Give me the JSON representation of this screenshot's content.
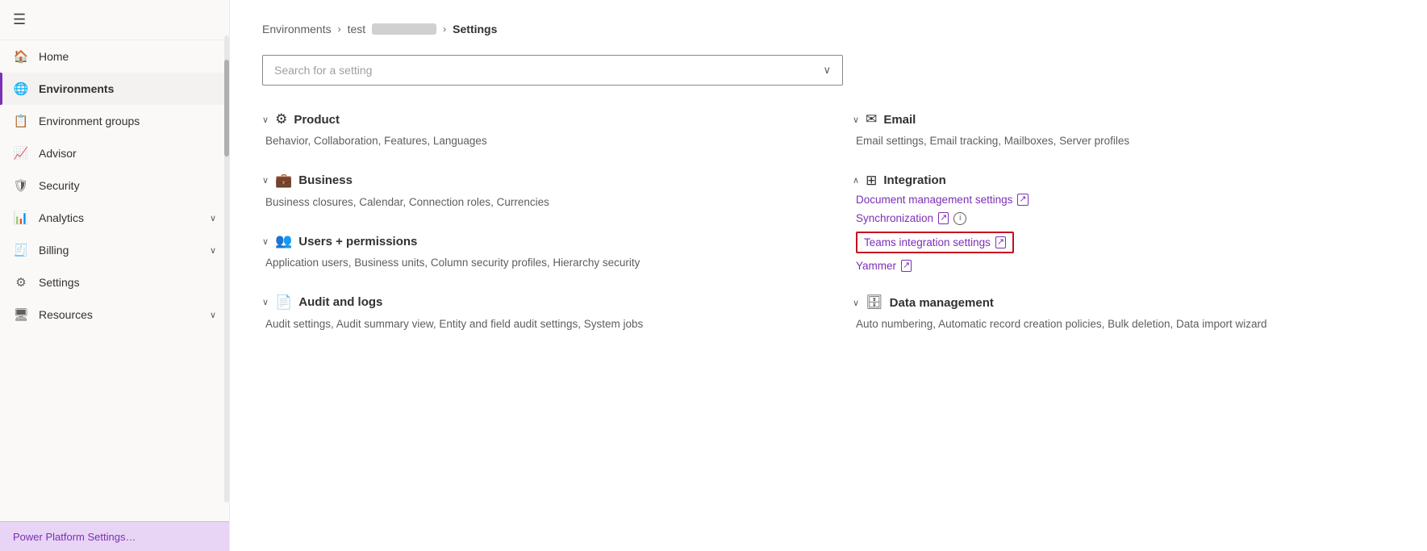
{
  "sidebar": {
    "hamburger_label": "≡",
    "items": [
      {
        "id": "home",
        "label": "Home",
        "icon": "🏠",
        "active": false,
        "has_chevron": false
      },
      {
        "id": "environments",
        "label": "Environments",
        "icon": "🌐",
        "active": true,
        "has_chevron": false
      },
      {
        "id": "environment-groups",
        "label": "Environment groups",
        "icon": "📋",
        "active": false,
        "has_chevron": false
      },
      {
        "id": "advisor",
        "label": "Advisor",
        "icon": "📈",
        "active": false,
        "has_chevron": false
      },
      {
        "id": "security",
        "label": "Security",
        "icon": "🛡",
        "active": false,
        "has_chevron": false
      },
      {
        "id": "analytics",
        "label": "Analytics",
        "icon": "📊",
        "active": false,
        "has_chevron": true
      },
      {
        "id": "billing",
        "label": "Billing",
        "icon": "🧾",
        "active": false,
        "has_chevron": true
      },
      {
        "id": "settings",
        "label": "Settings",
        "icon": "⚙",
        "active": false,
        "has_chevron": false
      },
      {
        "id": "resources",
        "label": "Resources",
        "icon": "🖥",
        "active": false,
        "has_chevron": true
      }
    ],
    "bottom_label": "Power Platform Settings"
  },
  "breadcrumb": {
    "environments": "Environments",
    "test": "test",
    "settings": "Settings"
  },
  "search": {
    "placeholder": "Search for a setting"
  },
  "sections_left": [
    {
      "id": "product",
      "title": "Product",
      "icon": "⚙",
      "items_text": "Behavior, Collaboration, Features, Languages"
    },
    {
      "id": "business",
      "title": "Business",
      "icon": "💼",
      "items_text": "Business closures, Calendar, Connection roles, Currencies"
    },
    {
      "id": "users-permissions",
      "title": "Users + permissions",
      "icon": "👥",
      "items_text": "Application users, Business units, Column security profiles, Hierarchy security"
    },
    {
      "id": "audit-logs",
      "title": "Audit and logs",
      "icon": "📄",
      "items_text": "Audit settings, Audit summary view, Entity and field audit settings, System jobs"
    }
  ],
  "sections_right": [
    {
      "id": "email",
      "title": "Email",
      "icon": "✉",
      "items_text": "Email settings, Email tracking, Mailboxes, Server profiles",
      "type": "plain"
    },
    {
      "id": "integration",
      "title": "Integration",
      "icon": "⊞",
      "type": "links",
      "links": [
        {
          "id": "document-management",
          "label": "Document management settings",
          "has_ext": true,
          "has_info": false,
          "highlighted": false
        },
        {
          "id": "synchronization",
          "label": "Synchronization",
          "has_ext": true,
          "has_info": true,
          "highlighted": false
        },
        {
          "id": "teams-integration",
          "label": "Teams integration settings",
          "has_ext": true,
          "has_info": false,
          "highlighted": true
        },
        {
          "id": "yammer",
          "label": "Yammer",
          "has_ext": true,
          "has_info": false,
          "highlighted": false
        }
      ]
    },
    {
      "id": "data-management",
      "title": "Data management",
      "icon": "🗄",
      "items_text": "Auto numbering, Automatic record creation policies, Bulk deletion, Data import wizard",
      "type": "plain"
    }
  ]
}
